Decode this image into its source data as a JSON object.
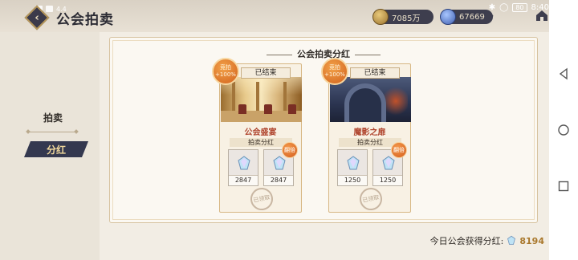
{
  "status_bar": {
    "left_text": "4.4",
    "time": "8:40",
    "battery": "80"
  },
  "header": {
    "title": "公会拍卖",
    "gold_amount": "7085万",
    "gem_amount": "67669"
  },
  "sidebar": {
    "items": [
      {
        "label": "拍卖",
        "active": false
      },
      {
        "label": "分红",
        "active": true
      }
    ]
  },
  "panel": {
    "title": "公会拍卖分红",
    "cards": [
      {
        "status": "已结束",
        "badge_line1": "竞拍",
        "badge_line2": "+100%",
        "name": "公会盛宴",
        "sub_label": "拍卖分红",
        "rewards": [
          {
            "value": "2847",
            "double": false
          },
          {
            "value": "2847",
            "double": true,
            "tag": "翻倍"
          }
        ],
        "stamp": "已领取"
      },
      {
        "status": "已结束",
        "badge_line1": "竞拍",
        "badge_line2": "+100%",
        "name": "魔影之扉",
        "sub_label": "拍卖分红",
        "rewards": [
          {
            "value": "1250",
            "double": false
          },
          {
            "value": "1250",
            "double": true,
            "tag": "翻倍"
          }
        ],
        "stamp": "已领取"
      }
    ]
  },
  "footer": {
    "label": "今日公会获得分红:",
    "amount": "8194"
  },
  "colors": {
    "accent_dark": "#34384f",
    "accent_gold": "#f2d99c",
    "card_name_red": "#b0462f",
    "badge_orange": "#d2621c"
  }
}
